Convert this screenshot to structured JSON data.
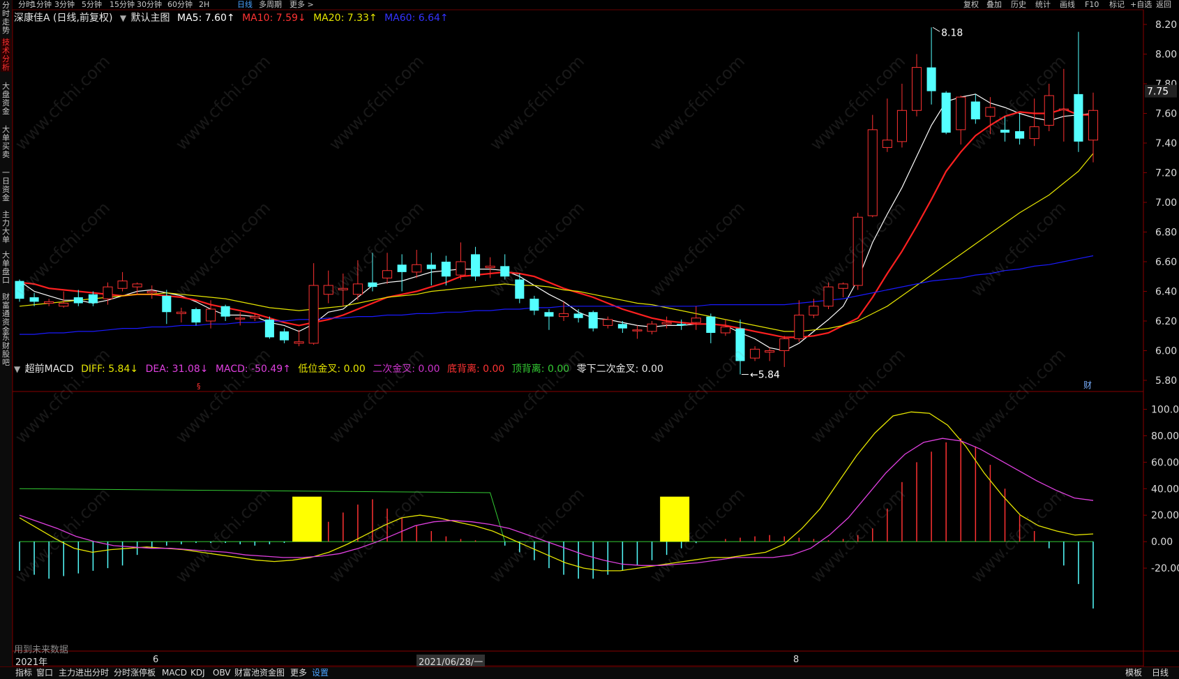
{
  "topbar": {
    "left_tabs": [
      "分时",
      "1分钟",
      "3分钟",
      "5分钟",
      "15分钟",
      "30分钟",
      "60分钟",
      "2H",
      "日线",
      "多周期",
      "更多 >"
    ],
    "active_tab": "日线",
    "right_tabs": [
      "复权",
      "叠加",
      "历史",
      "统计",
      "画线",
      "F10",
      "标记",
      "+自选",
      "返回"
    ]
  },
  "left_tabs": [
    "分时走势",
    "技术分析",
    "大盘资金",
    "大单买卖",
    "一日资金",
    "主力大单",
    "大单盘口",
    "财富通资金",
    "东财股吧"
  ],
  "left_active": "技术分析",
  "main_info": {
    "title": "深康佳A (日线,前复权)",
    "indicator": "默认主图",
    "ma5": "MA5: 7.60↑",
    "ma10": "MA10: 7.59↓",
    "ma20": "MA20: 7.33↑",
    "ma60": "MA60: 6.64↑"
  },
  "sub_info": {
    "title": "超前MACD",
    "diff": "DIFF: 5.84↓",
    "dea": "DEA: 31.08↓",
    "macd": "MACD: -50.49↑",
    "low_cross": "低位金叉: 0.00",
    "second_cross": "二次金叉: 0.00",
    "bottom_div": "底背离: 0.00",
    "top_div": "顶背离: 0.00",
    "below_zero_cross": "零下二次金叉: 0.00"
  },
  "future_data_note": "用到未来数据",
  "x_labels": [
    "2021年",
    "6",
    "2021/06/28/一",
    "8"
  ],
  "bottombar": {
    "left": [
      "指标",
      "窗口",
      "主力进出分时",
      "分时涨停板",
      "MACD",
      "KDJ",
      "OBV",
      "财富池资金图",
      "更多",
      "设置"
    ],
    "right": [
      "模板",
      "日线"
    ],
    "right_sub": "+ -"
  },
  "price_axis": [
    "8.20",
    "8.00",
    "7.80",
    "7.60",
    "7.40",
    "7.20",
    "7.00",
    "6.80",
    "6.60",
    "6.40",
    "6.20",
    "6.00",
    "5.80"
  ],
  "macd_axis": [
    "100.0",
    "80.00",
    "60.00",
    "40.00",
    "20.00",
    "0.00",
    "-20.00"
  ],
  "current_price_label": "7.75",
  "high_annotation": "8.18",
  "low_annotation": "5.84",
  "cai_marker": "财",
  "watermark": "www.cfchi.com",
  "colors": {
    "up": "#ff3232",
    "down": "#54ffff",
    "ma5": "#ffffff",
    "ma10": "#ff2020",
    "ma20": "#e6e600",
    "ma60": "#1a1aff",
    "diff": "#e6e600",
    "dea": "#e040e0",
    "zero_line": "#33cc33"
  },
  "chart_data": [
    {
      "type": "candlestick",
      "title": "深康佳A (日线,前复权)",
      "ylim": [
        5.75,
        8.25
      ],
      "candles": [
        [
          6.47,
          6.35,
          6.48,
          6.33
        ],
        [
          6.36,
          6.33,
          6.39,
          6.3
        ],
        [
          6.32,
          6.33,
          6.35,
          6.3
        ],
        [
          6.3,
          6.32,
          6.4,
          6.29
        ],
        [
          6.36,
          6.32,
          6.41,
          6.3
        ],
        [
          6.38,
          6.32,
          6.4,
          6.3
        ],
        [
          6.35,
          6.43,
          6.46,
          6.31
        ],
        [
          6.42,
          6.47,
          6.53,
          6.4
        ],
        [
          6.43,
          6.45,
          6.46,
          6.38
        ],
        [
          6.39,
          6.4,
          6.44,
          6.35
        ],
        [
          6.37,
          6.26,
          6.41,
          6.18
        ],
        [
          6.25,
          6.26,
          6.29,
          6.19
        ],
        [
          6.28,
          6.19,
          6.29,
          6.17
        ],
        [
          6.2,
          6.28,
          6.34,
          6.15
        ],
        [
          6.3,
          6.23,
          6.31,
          6.2
        ],
        [
          6.22,
          6.22,
          6.26,
          6.17
        ],
        [
          6.22,
          6.23,
          6.25,
          6.2
        ],
        [
          6.21,
          6.09,
          6.23,
          6.08
        ],
        [
          6.13,
          6.07,
          6.15,
          6.05
        ],
        [
          6.05,
          6.06,
          6.14,
          6.03
        ],
        [
          6.05,
          6.44,
          6.59,
          6.04
        ],
        [
          6.38,
          6.44,
          6.54,
          6.32
        ],
        [
          6.41,
          6.42,
          6.52,
          6.3
        ],
        [
          6.38,
          6.45,
          6.61,
          6.34
        ],
        [
          6.46,
          6.43,
          6.66,
          6.4
        ],
        [
          6.49,
          6.54,
          6.66,
          6.45
        ],
        [
          6.58,
          6.53,
          6.65,
          6.4
        ],
        [
          6.53,
          6.58,
          6.68,
          6.49
        ],
        [
          6.58,
          6.55,
          6.66,
          6.44
        ],
        [
          6.6,
          6.5,
          6.64,
          6.44
        ],
        [
          6.51,
          6.6,
          6.73,
          6.48
        ],
        [
          6.65,
          6.5,
          6.7,
          6.47
        ],
        [
          6.56,
          6.57,
          6.63,
          6.49
        ],
        [
          6.57,
          6.5,
          6.65,
          6.48
        ],
        [
          6.48,
          6.35,
          6.52,
          6.32
        ],
        [
          6.35,
          6.27,
          6.37,
          6.24
        ],
        [
          6.26,
          6.23,
          6.28,
          6.14
        ],
        [
          6.23,
          6.25,
          6.33,
          6.2
        ],
        [
          6.25,
          6.22,
          6.28,
          6.19
        ],
        [
          6.26,
          6.15,
          6.27,
          6.13
        ],
        [
          6.17,
          6.21,
          6.23,
          6.15
        ],
        [
          6.18,
          6.15,
          6.2,
          6.12
        ],
        [
          6.14,
          6.14,
          6.17,
          6.08
        ],
        [
          6.13,
          6.18,
          6.2,
          6.11
        ],
        [
          6.18,
          6.19,
          6.23,
          6.15
        ],
        [
          6.18,
          6.17,
          6.21,
          6.14
        ],
        [
          6.19,
          6.22,
          6.3,
          6.14
        ],
        [
          6.23,
          6.12,
          6.25,
          6.05
        ],
        [
          6.12,
          6.16,
          6.21,
          6.1
        ],
        [
          6.15,
          5.93,
          6.21,
          5.84
        ],
        [
          5.95,
          6.01,
          6.03,
          5.93
        ],
        [
          5.99,
          6.0,
          6.02,
          5.93
        ],
        [
          6.0,
          6.08,
          6.1,
          5.89
        ],
        [
          6.08,
          6.24,
          6.34,
          6.06
        ],
        [
          6.24,
          6.3,
          6.35,
          6.22
        ],
        [
          6.3,
          6.43,
          6.46,
          6.28
        ],
        [
          6.42,
          6.45,
          6.46,
          6.36
        ],
        [
          6.44,
          6.9,
          6.93,
          6.41
        ],
        [
          6.91,
          7.49,
          7.59,
          6.9
        ],
        [
          7.37,
          7.42,
          7.7,
          7.34
        ],
        [
          7.41,
          7.62,
          7.8,
          7.37
        ],
        [
          7.62,
          7.91,
          8.0,
          7.58
        ],
        [
          7.91,
          7.75,
          8.18,
          7.66
        ],
        [
          7.74,
          7.47,
          7.75,
          7.46
        ],
        [
          7.49,
          7.71,
          7.72,
          7.39
        ],
        [
          7.68,
          7.56,
          7.73,
          7.53
        ],
        [
          7.58,
          7.64,
          7.71,
          7.46
        ],
        [
          7.49,
          7.47,
          7.58,
          7.41
        ],
        [
          7.48,
          7.43,
          7.6,
          7.39
        ],
        [
          7.43,
          7.51,
          7.7,
          7.38
        ],
        [
          7.52,
          7.72,
          7.8,
          7.48
        ],
        [
          7.63,
          7.63,
          7.9,
          7.41
        ],
        [
          7.73,
          7.41,
          8.15,
          7.34
        ],
        [
          7.42,
          7.62,
          7.74,
          7.27
        ]
      ],
      "series": [
        {
          "name": "MA5",
          "values": [
            6.47,
            6.4,
            6.37,
            6.34,
            6.34,
            6.32,
            6.34,
            6.37,
            6.4,
            6.41,
            6.39,
            6.37,
            6.33,
            6.28,
            6.24,
            6.24,
            6.23,
            6.19,
            6.17,
            6.13,
            6.18,
            6.26,
            6.28,
            6.36,
            6.44,
            6.46,
            6.47,
            6.5,
            6.53,
            6.54,
            6.55,
            6.55,
            6.55,
            6.54,
            6.5,
            6.44,
            6.38,
            6.33,
            6.26,
            6.22,
            6.21,
            6.19,
            6.17,
            6.16,
            6.17,
            6.17,
            6.18,
            6.18,
            6.17,
            6.12,
            6.08,
            6.02,
            6.0,
            6.05,
            6.13,
            6.21,
            6.3,
            6.48,
            6.73,
            6.92,
            7.1,
            7.31,
            7.52,
            7.68,
            7.71,
            7.73,
            7.67,
            7.64,
            7.6,
            7.57,
            7.55,
            7.58,
            7.59,
            7.6
          ]
        },
        {
          "name": "MA10",
          "values": [
            6.46,
            6.45,
            6.42,
            6.41,
            6.4,
            6.39,
            6.38,
            6.37,
            6.38,
            6.38,
            6.37,
            6.36,
            6.34,
            6.31,
            6.29,
            6.27,
            6.25,
            6.22,
            6.19,
            6.17,
            6.19,
            6.21,
            6.24,
            6.28,
            6.32,
            6.36,
            6.38,
            6.4,
            6.43,
            6.46,
            6.5,
            6.51,
            6.52,
            6.53,
            6.52,
            6.5,
            6.46,
            6.42,
            6.39,
            6.36,
            6.32,
            6.28,
            6.25,
            6.22,
            6.2,
            6.19,
            6.18,
            6.18,
            6.17,
            6.15,
            6.13,
            6.11,
            6.09,
            6.09,
            6.1,
            6.12,
            6.17,
            6.22,
            6.36,
            6.52,
            6.67,
            6.84,
            7.02,
            7.21,
            7.34,
            7.45,
            7.52,
            7.58,
            7.61,
            7.6,
            7.6,
            7.63,
            7.59,
            7.59
          ]
        },
        {
          "name": "MA20",
          "values": [
            6.3,
            6.31,
            6.32,
            6.33,
            6.34,
            6.35,
            6.36,
            6.37,
            6.38,
            6.38,
            6.39,
            6.38,
            6.37,
            6.36,
            6.35,
            6.33,
            6.31,
            6.29,
            6.28,
            6.27,
            6.28,
            6.29,
            6.3,
            6.32,
            6.34,
            6.36,
            6.37,
            6.38,
            6.4,
            6.41,
            6.42,
            6.43,
            6.44,
            6.45,
            6.44,
            6.44,
            6.43,
            6.41,
            6.4,
            6.38,
            6.36,
            6.34,
            6.32,
            6.31,
            6.29,
            6.27,
            6.25,
            6.23,
            6.21,
            6.19,
            6.17,
            6.15,
            6.13,
            6.13,
            6.14,
            6.15,
            6.17,
            6.2,
            6.25,
            6.3,
            6.37,
            6.44,
            6.51,
            6.58,
            6.65,
            6.72,
            6.79,
            6.86,
            6.93,
            6.99,
            7.05,
            7.13,
            7.21,
            7.33
          ]
        },
        {
          "name": "MA60",
          "values": [
            6.11,
            6.11,
            6.12,
            6.12,
            6.13,
            6.13,
            6.14,
            6.15,
            6.15,
            6.16,
            6.16,
            6.17,
            6.17,
            6.18,
            6.18,
            6.19,
            6.19,
            6.2,
            6.2,
            6.21,
            6.21,
            6.22,
            6.22,
            6.23,
            6.23,
            6.24,
            6.24,
            6.25,
            6.25,
            6.26,
            6.26,
            6.27,
            6.27,
            6.28,
            6.28,
            6.29,
            6.29,
            6.3,
            6.3,
            6.3,
            6.3,
            6.3,
            6.3,
            6.3,
            6.3,
            6.3,
            6.3,
            6.31,
            6.31,
            6.31,
            6.31,
            6.31,
            6.31,
            6.32,
            6.33,
            6.34,
            6.35,
            6.37,
            6.39,
            6.41,
            6.43,
            6.45,
            6.47,
            6.48,
            6.49,
            6.51,
            6.52,
            6.54,
            6.55,
            6.57,
            6.58,
            6.6,
            6.62,
            6.64
          ]
        }
      ]
    },
    {
      "type": "bar",
      "title": "超前MACD",
      "ylim": [
        -60,
        105
      ],
      "series": [
        {
          "name": "MACD",
          "values": [
            -22,
            -25,
            -28,
            -26,
            -24,
            -22,
            -20,
            -18,
            -10,
            -5,
            -3,
            -2,
            -1,
            -1,
            -1,
            -2,
            -3,
            -2,
            -1,
            2,
            8,
            15,
            22,
            28,
            32,
            25,
            18,
            12,
            8,
            4,
            2,
            1,
            0,
            -3,
            -8,
            -14,
            -20,
            -25,
            -28,
            -28,
            -25,
            -22,
            -18,
            -14,
            -10,
            -5,
            -1,
            0,
            2,
            3,
            4,
            5,
            4,
            3,
            2,
            1,
            2,
            5,
            10,
            25,
            45,
            60,
            68,
            75,
            78,
            72,
            58,
            40,
            20,
            8,
            -5,
            -18,
            -32,
            -50.49
          ]
        },
        {
          "name": "DIFF",
          "values": [
            18,
            10,
            2,
            -5,
            -8,
            -6,
            -5,
            -4,
            -5,
            -6,
            -8,
            -10,
            -12,
            -14,
            -15,
            -14,
            -12,
            -8,
            -2,
            5,
            12,
            18,
            20,
            18,
            15,
            12,
            8,
            2,
            -4,
            -10,
            -16,
            -20,
            -22,
            -22,
            -20,
            -18,
            -16,
            -14,
            -12,
            -12,
            -10,
            -8,
            -2,
            10,
            25,
            45,
            65,
            82,
            95,
            98,
            97,
            88,
            72,
            52,
            35,
            20,
            12,
            8,
            5,
            5.84
          ]
        },
        {
          "name": "DEA",
          "values": [
            20,
            15,
            10,
            4,
            0,
            -3,
            -4,
            -5,
            -5,
            -6,
            -7,
            -8,
            -10,
            -11,
            -12,
            -12,
            -11,
            -9,
            -5,
            0,
            6,
            12,
            15,
            16,
            15,
            13,
            10,
            5,
            0,
            -5,
            -10,
            -14,
            -17,
            -18,
            -18,
            -17,
            -16,
            -14,
            -12,
            -12,
            -12,
            -10,
            -5,
            5,
            18,
            35,
            52,
            66,
            75,
            78,
            76,
            70,
            62,
            54,
            46,
            39,
            33,
            31.08
          ]
        },
        {
          "name": "DIFF-upper",
          "values": []
        }
      ],
      "signals": {
        "low_cross_markers": 2
      }
    }
  ]
}
